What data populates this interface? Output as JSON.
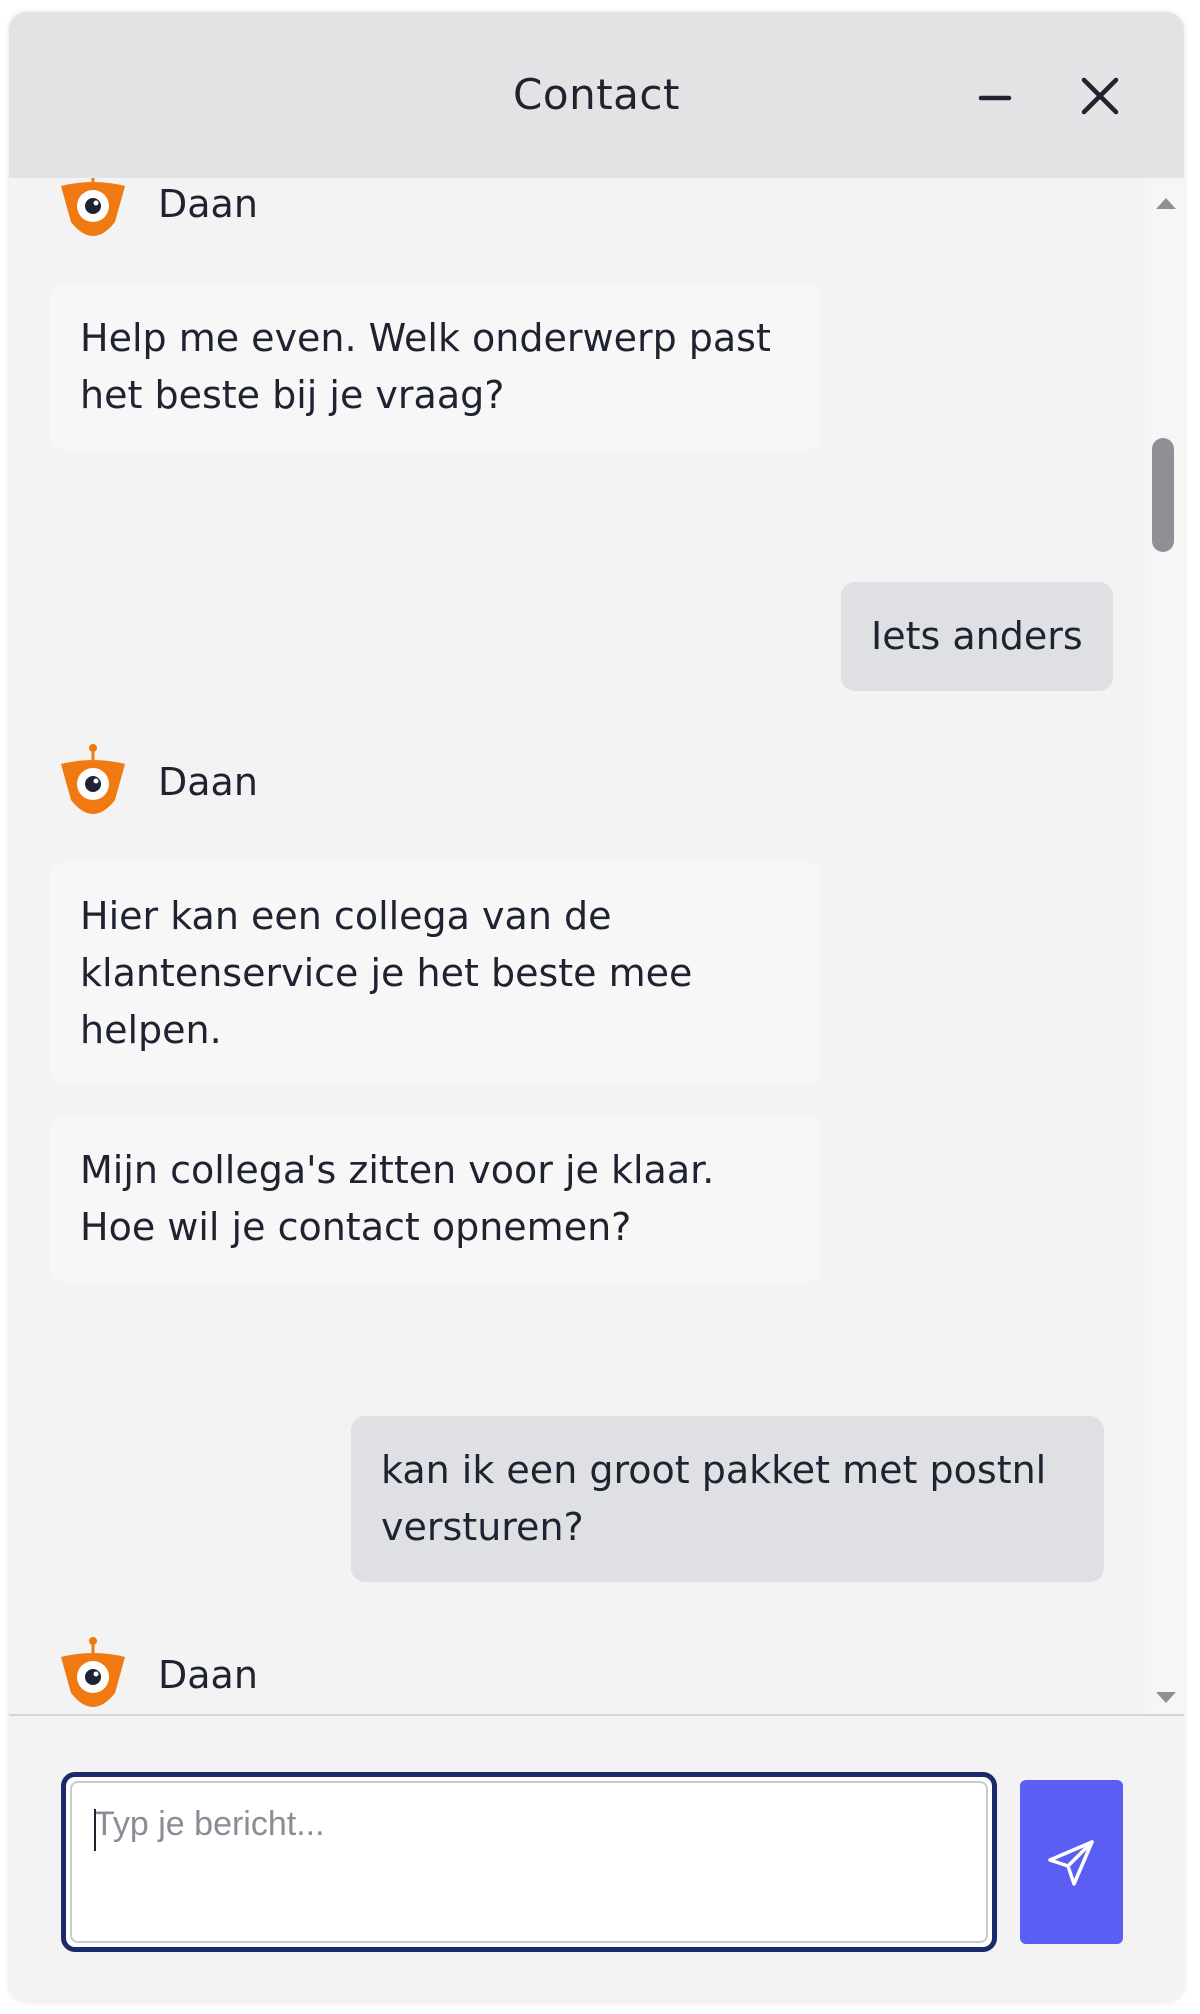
{
  "header": {
    "title": "Contact",
    "minimize_icon": "minus-icon",
    "close_icon": "close-icon"
  },
  "messages": [
    {
      "type": "agent_name",
      "text": "Daan"
    },
    {
      "type": "agent",
      "text": "Help me even. Welk onderwerp past het beste bij je vraag?"
    },
    {
      "type": "user",
      "text": "Iets anders"
    },
    {
      "type": "agent_name",
      "text": "Daan"
    },
    {
      "type": "agent",
      "text": "Hier kan een collega van de klantenservice je het beste mee helpen."
    },
    {
      "type": "agent",
      "text": "Mijn collega's zitten voor je klaar. Hoe wil je contact opnemen?"
    },
    {
      "type": "user",
      "text": "kan ik een groot pakket met postnl versturen?"
    },
    {
      "type": "agent_name",
      "text": "Daan"
    }
  ],
  "composer": {
    "placeholder": "Typ je bericht...",
    "value": "",
    "send_icon": "send-icon"
  },
  "colors": {
    "header_bg": "#e3e3e6",
    "panel_bg": "#f3f3f4",
    "agent_bubble": "#f7f7f8",
    "user_bubble": "#dfe0e4",
    "send_button": "#5b5ef3",
    "input_focus_border": "#1c2a6b",
    "avatar_orange": "#f07a11"
  }
}
